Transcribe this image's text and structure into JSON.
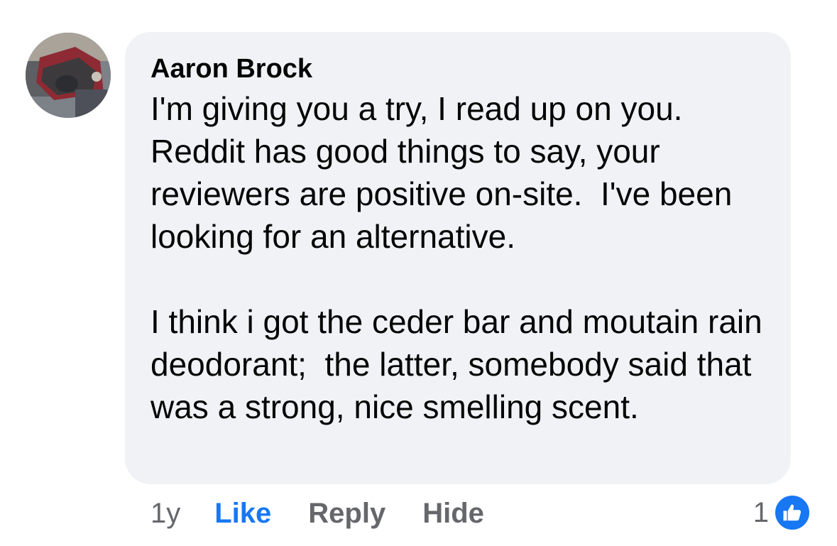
{
  "comment": {
    "author": "Aaron Brock",
    "text": "I'm giving you a try, I read up on you. Reddit has good things to say, your reviewers are positive on-site.  I've been looking for an alternative.\n\nI think i got the ceder bar and moutain rain deodorant;  the latter, somebody said that was a strong, nice smelling scent.",
    "time": "1y",
    "reaction_count": "1"
  },
  "actions": {
    "like": "Like",
    "reply": "Reply",
    "hide": "Hide"
  },
  "colors": {
    "bubble": "#f0f2f5",
    "like_blue": "#1877f2",
    "secondary_text": "#65676b"
  },
  "icons": {
    "avatar": "profile-photo",
    "reaction": "thumbs-up-icon"
  }
}
